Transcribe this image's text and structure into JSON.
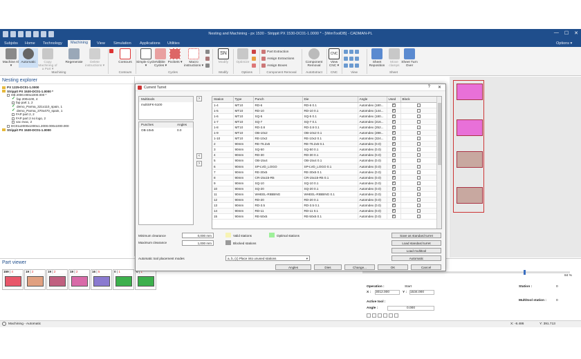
{
  "window": {
    "title": "Nesting and Machining - px 1530 - Strippit PX 1530-DC01-1.0000 * - [WimToolDB] - CADMAN-PL",
    "controls": [
      "—",
      "☐",
      "✕"
    ]
  },
  "menu": {
    "tabs": [
      "Subjobs",
      "Home",
      "Technology",
      "Machining",
      "View",
      "Simulation",
      "Applications",
      "Utilities"
    ],
    "active": "Machining",
    "options": "Options ▾"
  },
  "ribbon": {
    "buttons": [
      {
        "label": "Machine All ▾",
        "icon": "machine-all-icon"
      },
      {
        "label": "Automatic",
        "icon": "automatic-icon"
      },
      {
        "label": "Copy Machining of a Part ▾",
        "icon": "copy-machining-icon"
      },
      {
        "label": "Regenerate",
        "icon": "regenerate-icon"
      },
      {
        "label": "Delete instructions ▾",
        "icon": "delete-instructions-icon"
      },
      {
        "label": "Contours",
        "icon": "contours-icon"
      },
      {
        "label": "Simple Cycle ▾",
        "icon": "simple-cycle-icon"
      },
      {
        "label": "Nibble Cycles ▾",
        "icon": "nibble-cycles-icon"
      },
      {
        "label": "Pockets ▾",
        "icon": "pockets-icon"
      },
      {
        "label": "Macro instructions ▾",
        "icon": "macro-instructions-icon"
      },
      {
        "label": "Modify",
        "icon": "modify-icon"
      },
      {
        "label": "Optimize",
        "icon": "optimize-icon"
      },
      {
        "label": "Component Removal",
        "icon": "component-removal-icon"
      },
      {
        "label": "View CNC ▾",
        "icon": "view-cnc-icon"
      },
      {
        "label": "Sheet Reposition",
        "icon": "sheet-reposition-icon"
      },
      {
        "label": "Move clamps",
        "icon": "move-clamps-icon"
      },
      {
        "label": "Sheet Turn Over",
        "icon": "sheet-turn-over-icon"
      }
    ],
    "small_items": [
      "Part Extraction",
      "Assign Extractions",
      "Assign Boxes"
    ],
    "groups": [
      "Machining",
      "Contours",
      "Cycles",
      "Modify",
      "Options",
      "Component Removal",
      "AutoExtract",
      "CNC",
      "View",
      "Sheet"
    ]
  },
  "nesting_explorer": {
    "title": "Nesting explorer",
    "items": [
      {
        "text": "PX 1225-DC01-1.0000",
        "bold": true,
        "indent": 0,
        "kind": "folder"
      },
      {
        "text": "Strippit PX 1530-DC01-1.0000 *",
        "bold": true,
        "indent": 0,
        "kind": "folder"
      },
      {
        "text": "HB 2000.000x1000.000 *",
        "bold": false,
        "indent": 1,
        "kind": "box"
      },
      {
        "text": "fap 200x100, 4",
        "bold": false,
        "indent": 2,
        "kind": "check"
      },
      {
        "text": "fap part 1, 2",
        "bold": false,
        "indent": 2,
        "kind": "box"
      },
      {
        "text": "demo_Parma_321x110_spain, 1",
        "bold": false,
        "indent": 2,
        "kind": "check"
      },
      {
        "text": "demo_Parma_370x470_spain, 1",
        "bold": false,
        "indent": 2,
        "kind": "check"
      },
      {
        "text": "FAP part 2, 2",
        "bold": false,
        "indent": 2,
        "kind": "box"
      },
      {
        "text": "FAP part 2 no logo, 2",
        "bold": false,
        "indent": 2,
        "kind": "box"
      },
      {
        "text": "vac evac, 2",
        "bold": false,
        "indent": 2,
        "kind": "box"
      },
      {
        "text": "DC01x2000x1000x1.2000.000x1000.000",
        "bold": false,
        "indent": 1,
        "kind": "box"
      },
      {
        "text": "Strippit PX 1530-DC01-1.0000",
        "bold": true,
        "indent": 0,
        "kind": "folder"
      }
    ]
  },
  "part_viewer": {
    "title": "Part viewer",
    "cells": [
      {
        "count": "159",
        "sel": "4",
        "color": "#e8576a"
      },
      {
        "count": "19",
        "sel": "2",
        "color": "#e0a080"
      },
      {
        "count": "19",
        "sel": "2",
        "color": "#c06080"
      },
      {
        "count": "19",
        "sel": "2",
        "color": "#d86aa8"
      },
      {
        "count": "16",
        "sel": "5",
        "color": "#8a7ad0"
      },
      {
        "count": "0",
        "sel": "1",
        "color": "#3cb04c"
      },
      {
        "count": "0",
        "sel": "1",
        "color": "#3cb04c"
      }
    ]
  },
  "status": {
    "left": "Machining - Automatic",
    "x": "X: -8.486",
    "y": "Y: 391.713"
  },
  "operations": {
    "zoom": "84 %",
    "operation_label": "Operation :",
    "operation_value": "Start",
    "x_label": "X :",
    "x_value": "3012.000",
    "y_label": "Y :",
    "y_value": "1534.000",
    "active_tool": "Active tool :",
    "angle_label": "Angle :",
    "angle_value": "0.000",
    "station_label": "Station :",
    "station_value": "0",
    "multitool_label": "Multitool station :",
    "multitool_value": "0"
  },
  "dialog": {
    "title": "Current Turret",
    "help": "?",
    "close": "✕",
    "multitools_header": "Multitools",
    "multitools": [
      "multiSFK-5100"
    ],
    "punches_header": "Punches",
    "angles_header": "Angles",
    "punches": [
      {
        "name": "OB-10x5",
        "angle": "0.0"
      }
    ],
    "columns": [
      "Station",
      "Type",
      "Punch",
      "Die",
      "Angle",
      "Used",
      "Block"
    ],
    "rows": [
      {
        "station": "1-4",
        "type": "MT10",
        "punch": "RD-6",
        "die": "RD-6 0.1",
        "angle": "AutoIndex (180...",
        "used": true,
        "block": false
      },
      {
        "station": "1-5",
        "type": "MT10",
        "punch": "RD-10",
        "die": "RD-10 0.1",
        "angle": "AutoIndex (144...",
        "used": true,
        "block": false
      },
      {
        "station": "1-6",
        "type": "MT10",
        "punch": "SQ-5",
        "die": "SQ-5 0.1",
        "angle": "AutoIndex (180...",
        "used": true,
        "block": false
      },
      {
        "station": "1-7",
        "type": "MT10",
        "punch": "SQ-7",
        "die": "SQ-7 0.1",
        "angle": "AutoIndex (216...",
        "used": true,
        "block": false
      },
      {
        "station": "1-8",
        "type": "MT10",
        "punch": "RD-3.8",
        "die": "RD-3.8 0.1",
        "angle": "AutoIndex (252...",
        "used": true,
        "block": false
      },
      {
        "station": "1-9",
        "type": "MT10",
        "punch": "OB-10x2",
        "die": "OB-10x2 0.1",
        "angle": "AutoIndex (288...",
        "used": true,
        "block": false
      },
      {
        "station": "1-10",
        "type": "MT10",
        "punch": "RE-10x2",
        "die": "RE-10x2 0.1",
        "angle": "AutoIndex (324...",
        "used": true,
        "block": false
      },
      {
        "station": "2",
        "type": "90mm",
        "punch": "RE-76.2x5",
        "die": "RE-76.2x5 0.1",
        "angle": "AutoIndex (0.0)",
        "used": true,
        "block": false
      },
      {
        "station": "3",
        "type": "90mm",
        "punch": "SQ-50",
        "die": "SQ-50 0.1",
        "angle": "AutoIndex (0.0)",
        "used": true,
        "block": false
      },
      {
        "station": "4",
        "type": "90mm",
        "punch": "RD-30",
        "die": "RD-30 0.1",
        "angle": "AutoIndex (0.0)",
        "used": true,
        "block": false
      },
      {
        "station": "5",
        "type": "90mm",
        "punch": "OB-15x4",
        "die": "OB-15x4 0.1",
        "angle": "AutoIndex (0.0)",
        "used": true,
        "block": false
      },
      {
        "station": "6",
        "type": "90mm",
        "punch": "SP-LVD_LOGO",
        "die": "SP-LVD_LOGO 0.1",
        "angle": "AutoIndex (0.0)",
        "used": true,
        "block": false
      },
      {
        "station": "7",
        "type": "90mm",
        "punch": "RE-30x5",
        "die": "RE-30x5 0.1",
        "angle": "AutoIndex (0.0)",
        "used": true,
        "block": false
      },
      {
        "station": "8",
        "type": "90mm",
        "punch": "CR-15x15-R5",
        "die": "CR-15x15-R5 0.1",
        "angle": "AutoIndex (0.0)",
        "used": true,
        "block": false
      },
      {
        "station": "9",
        "type": "90mm",
        "punch": "SQ-10",
        "die": "SQ-10 0.1",
        "angle": "AutoIndex (0.0)",
        "used": true,
        "block": false
      },
      {
        "station": "10",
        "type": "90mm",
        "punch": "SQ-20",
        "die": "SQ-20 0.1",
        "angle": "AutoIndex (0.0)",
        "used": true,
        "block": false
      },
      {
        "station": "11",
        "type": "90mm",
        "punch": "WHEEL-RIBBING",
        "die": "WHEEL-RIBBING 0.1",
        "angle": "AutoIndex (0.0)",
        "used": false,
        "block": false
      },
      {
        "station": "12",
        "type": "90mm",
        "punch": "RD-20",
        "die": "RD-20 0.1",
        "angle": "AutoIndex (0.0)",
        "used": true,
        "block": false
      },
      {
        "station": "13",
        "type": "90mm",
        "punch": "RD-3.5",
        "die": "RD-3.5 0.1",
        "angle": "AutoIndex (0.0)",
        "used": true,
        "block": false
      },
      {
        "station": "14",
        "type": "90mm",
        "punch": "RD-11",
        "die": "RD-11 0.1",
        "angle": "AutoIndex (0.0)",
        "used": true,
        "block": false
      },
      {
        "station": "15",
        "type": "90mm",
        "punch": "RE-50x5",
        "die": "RE-50x5 0.1",
        "angle": "AutoIndex (0.0)",
        "used": true,
        "block": false
      }
    ],
    "min_clearance_label": "Minimum clearance",
    "min_clearance_value": "0,000 mm",
    "max_clearance_label": "Maximum clearance",
    "max_clearance_value": "1,000 mm",
    "legend": [
      {
        "label": "Valid stations",
        "color": "#f7f3b4"
      },
      {
        "label": "Optimal stations",
        "color": "#9ef09a"
      },
      {
        "label": "Blocked stations",
        "color": "#9a9a9a"
      }
    ],
    "side_buttons": [
      "Save as standard turret",
      "Load standard turret",
      "Load multitool",
      "Automatic"
    ],
    "placement_label": "Automatic tool placement modes",
    "placement_value": "a, b, (c) Place into unused stations",
    "bottom_buttons": [
      "Angles",
      "Dies",
      "Change...",
      "OK",
      "Cancel"
    ]
  }
}
